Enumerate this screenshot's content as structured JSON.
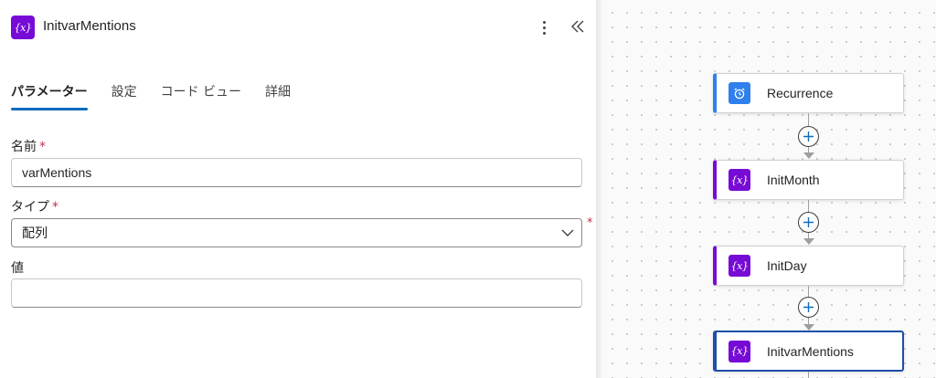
{
  "panel": {
    "title": "InitvarMentions",
    "badge_glyph": "{x}",
    "tabs": [
      {
        "label": "パラメーター",
        "active": true
      },
      {
        "label": "設定",
        "active": false
      },
      {
        "label": "コード ビュー",
        "active": false
      },
      {
        "label": "詳細",
        "active": false
      }
    ],
    "fields": {
      "name": {
        "label": "名前",
        "required_mark": "*",
        "value": "varMentions"
      },
      "type": {
        "label": "タイプ",
        "required_mark": "*",
        "value": "配列"
      },
      "value": {
        "label": "値",
        "value": ""
      }
    },
    "icons": {
      "more": "more-vertical-icon",
      "collapse": "double-chevron-left-icon",
      "dropdown": "chevron-down-icon"
    }
  },
  "flow": {
    "nodes": [
      {
        "label": "Recurrence",
        "icon": "alarm-clock-icon",
        "color": "#2f80ed"
      },
      {
        "label": "InitMonth",
        "icon": "variable-icon",
        "color": "#770bd6"
      },
      {
        "label": "InitDay",
        "icon": "variable-icon",
        "color": "#770bd6"
      },
      {
        "label": "InitvarMentions",
        "icon": "variable-icon",
        "color": "#770bd6",
        "selected": true
      }
    ]
  },
  "colors": {
    "variable_purple": "#770bd6",
    "schedule_blue": "#2f80ed",
    "tab_underline": "#0f6cbd",
    "required_red": "#c4314b",
    "selected_border": "#1f4fa8"
  }
}
